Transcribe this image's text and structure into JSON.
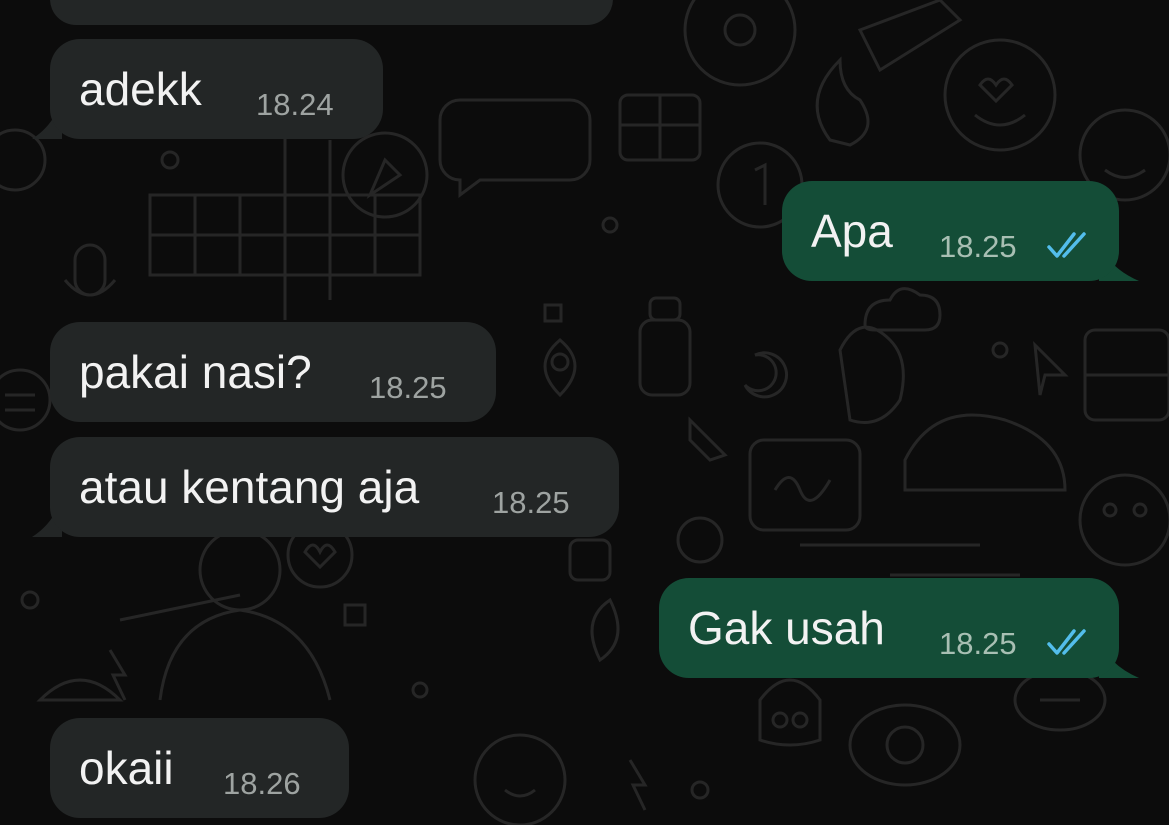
{
  "chat": {
    "messages": [
      {
        "direction": "incoming",
        "text": "",
        "time": ""
      },
      {
        "direction": "incoming",
        "text": "adekk",
        "time": "18.24"
      },
      {
        "direction": "outgoing",
        "text": "Apa",
        "time": "18.25",
        "status_icon": "double-check-read-icon"
      },
      {
        "direction": "incoming",
        "text": "pakai nasi?",
        "time": "18.25"
      },
      {
        "direction": "incoming",
        "text": "atau kentang aja",
        "time": "18.25"
      },
      {
        "direction": "outgoing",
        "text": "Gak usah",
        "time": "18.25",
        "status_icon": "double-check-read-icon"
      },
      {
        "direction": "incoming",
        "text": "okaii",
        "time": "18.26"
      }
    ]
  },
  "colors": {
    "background": "#0c0c0c",
    "incoming_bubble": "#232626",
    "outgoing_bubble": "#144d37",
    "read_ticks": "#53bdeb",
    "text": "#f2f2f2",
    "timestamp": "#9ea3a1"
  }
}
